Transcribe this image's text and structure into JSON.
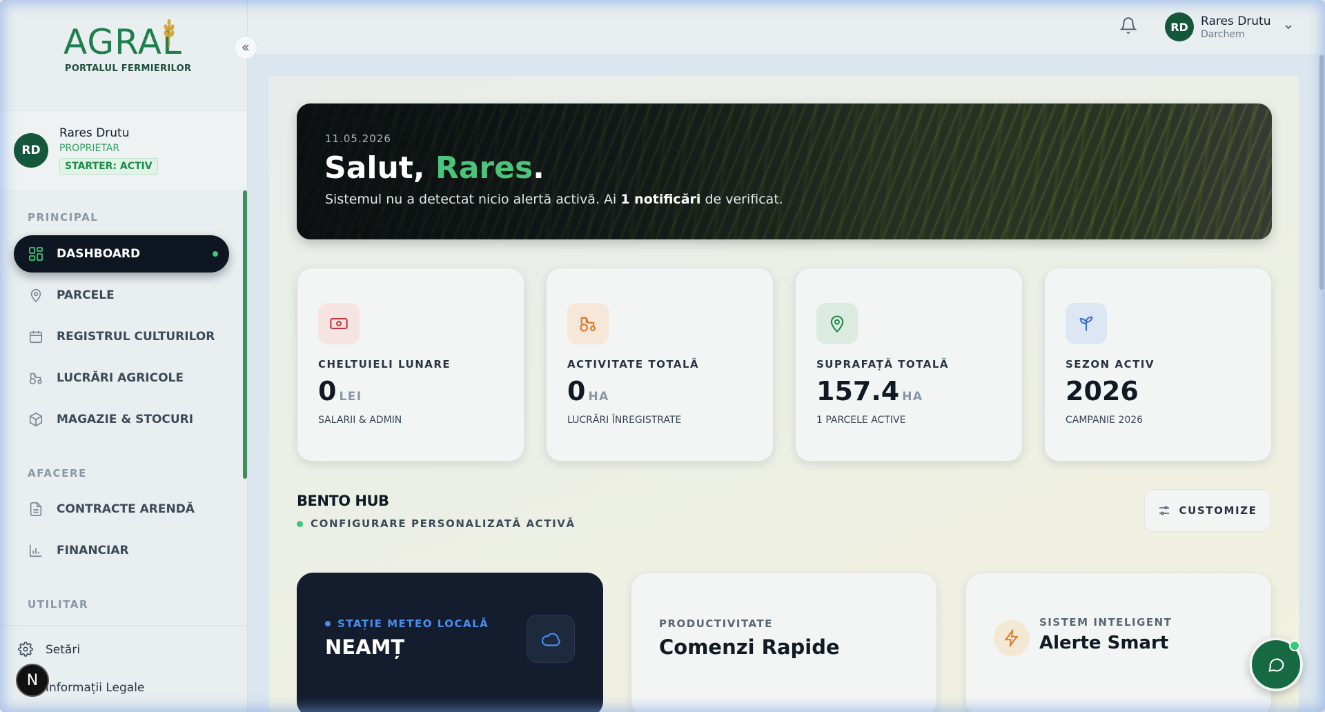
{
  "brand": {
    "logo_word": "AGRAL",
    "logo_tagline": "PORTALUL FERMIERILOR"
  },
  "sidebar": {
    "user": {
      "initials": "RD",
      "name": "Rares Drutu",
      "role": "PROPRIETAR",
      "plan_badge": "STARTER: ACTIV"
    },
    "sections": {
      "principal": "PRINCIPAL",
      "afacere": "AFACERE",
      "utilitar": "UTILITAR"
    },
    "items": [
      {
        "label": "DASHBOARD",
        "icon": "grid-icon",
        "active": true
      },
      {
        "label": "PARCELE",
        "icon": "map-pin-icon"
      },
      {
        "label": "REGISTRUL CULTURILOR",
        "icon": "calendar-icon"
      },
      {
        "label": "LUCRĂRI AGRICOLE",
        "icon": "tractor-icon"
      },
      {
        "label": "MAGAZIE & STOCURI",
        "icon": "box-icon"
      },
      {
        "label": "CONTRACTE ARENDĂ",
        "icon": "document-icon"
      },
      {
        "label": "FINANCIAR",
        "icon": "bar-chart-icon"
      }
    ],
    "bottom": {
      "settings": "Setări",
      "legal": "Informații Legale"
    },
    "floating_badge": "N"
  },
  "topbar": {
    "user_initials": "RD",
    "user_name": "Rares Drutu",
    "company": "Darchem"
  },
  "hero": {
    "date": "11.05.2026",
    "greeting_prefix": "Salut, ",
    "greeting_name": "Rares",
    "greeting_suffix": ".",
    "subtitle_prefix": "Sistemul nu a detectat nicio alertă activă. Ai ",
    "subtitle_bold": "1 notificări",
    "subtitle_suffix": " de verificat."
  },
  "stats": [
    {
      "label": "CHELTUIELI LUNARE",
      "value": "0",
      "unit": "LEI",
      "caption": "SALARII & ADMIN",
      "icon": "banknote-icon",
      "color": "#c9343c",
      "bg": "#f6e4e2"
    },
    {
      "label": "ACTIVITATE TOTALĂ",
      "value": "0",
      "unit": "HA",
      "caption": "LUCRĂRI ÎNREGISTRATE",
      "icon": "tractor-icon",
      "color": "#d9782a",
      "bg": "#f6e7d9"
    },
    {
      "label": "SUPRAFAȚĂ TOTALĂ",
      "value": "157.4",
      "unit": "HA",
      "caption": "1 PARCELE ACTIVE",
      "icon": "map-pin-icon",
      "color": "#1f8a4e",
      "bg": "#dcebe2"
    },
    {
      "label": "SEZON ACTIV",
      "value": "2026",
      "unit": "",
      "caption": "CAMPANIE 2026",
      "icon": "sprout-icon",
      "color": "#3a6fd0",
      "bg": "#dde6f3"
    }
  ],
  "bento": {
    "title": "BENTO HUB",
    "subtitle": "CONFIGURARE PERSONALIZATĂ ACTIVĂ",
    "customize_label": "CUSTOMIZE",
    "tiles": [
      {
        "kicker": "STAȚIE METEO LOCALĂ",
        "title": "NEAMȚ",
        "icon": "cloud-icon"
      },
      {
        "kicker": "PRODUCTIVITATE",
        "title": "Comenzi Rapide"
      },
      {
        "kicker": "SISTEM INTELIGENT",
        "title": "Alerte Smart",
        "icon": "lightning-icon"
      }
    ]
  },
  "colors": {
    "accent_green": "#1e7f4c",
    "active_nav": "#0e1622",
    "status_dot": "#3ac977"
  }
}
